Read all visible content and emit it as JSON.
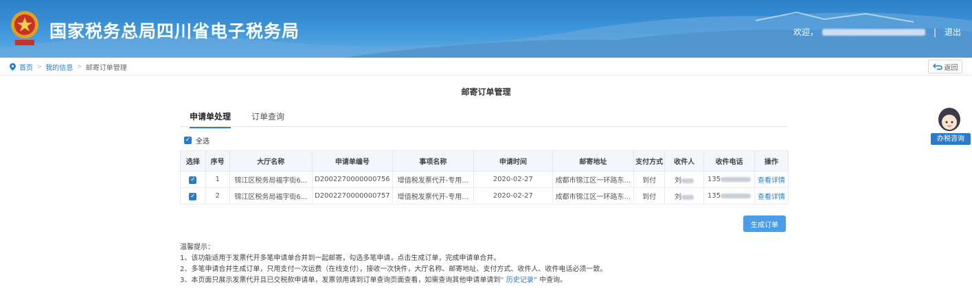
{
  "header": {
    "site_title": "国家税务总局四川省电子税务局",
    "welcome": "欢迎，",
    "separator": "|",
    "logout": "退出"
  },
  "breadcrumb": {
    "home": "首页",
    "my_info": "我的信息",
    "current": "邮寄订单管理",
    "arrow": ">"
  },
  "back_label": "返回",
  "helper_label": "办税咨询",
  "page_title": "邮寄订单管理",
  "tabs": [
    "申请单处理",
    "订单查询"
  ],
  "select_all": "全选",
  "table": {
    "headers": [
      "选择",
      "序号",
      "大厅名称",
      "申请单编号",
      "事项名称",
      "申请时间",
      "邮寄地址",
      "支付方式",
      "收件人",
      "收件电话",
      "操作"
    ],
    "rows": [
      {
        "no": "1",
        "hall": "锦江区税务局福字街6...",
        "app_no": "D2002270000000756",
        "item": "增值税发票代开-专用...",
        "time": "2020-02-27",
        "address": "成都市锦江区一环路东...",
        "payment": "到付",
        "recipient": "刘",
        "phone": "135",
        "action": "查看详情"
      },
      {
        "no": "2",
        "hall": "锦江区税务局福字街6...",
        "app_no": "D2002270000000757",
        "item": "增值税发票代开-专用...",
        "time": "2020-02-27",
        "address": "成都市锦江区一环路东...",
        "payment": "到付",
        "recipient": "刘",
        "phone": "135",
        "action": "查看详情"
      }
    ]
  },
  "generate_button": "生成订单",
  "tips": {
    "title": "温馨提示：",
    "line1": "1、该功能适用于发票代开多笔申请单合并到一起邮寄，勾选多笔申请，点击生成订单，完成申请单合并。",
    "line2": "2、多笔申请合并生成订单，只用支付一次运费（在线支付），接收一次快件，大厅名称、邮寄地址、支付方式、收件人、收件电话必须一致。",
    "line3_prefix": "3、本页面只展示发票代开且已交税款申请单，发票领用请到订单查询页面查看，如需查询其他申请单请到",
    "line3_link": "“ 历史记录”",
    "line3_suffix": " 中查询。"
  },
  "colors": {
    "header_blue": "#2d7fc6",
    "accent": "#2a7cc8",
    "button": "#4a9de8"
  }
}
